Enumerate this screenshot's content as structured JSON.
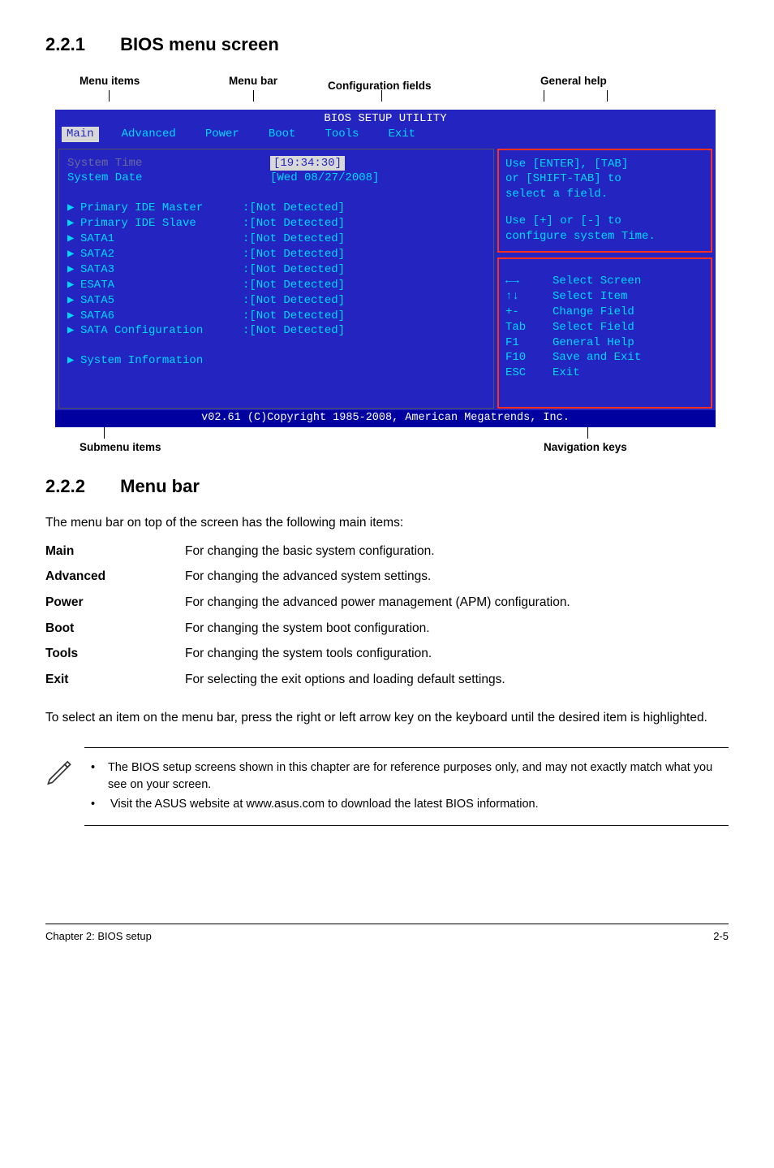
{
  "section1": {
    "num": "2.2.1",
    "title": "BIOS menu screen"
  },
  "topLabels": {
    "menuItems": "Menu items",
    "menuBar": "Menu bar",
    "config": "Configuration fields",
    "help": "General help"
  },
  "bios": {
    "title": "BIOS SETUP UTILITY",
    "menubar": [
      "Main",
      "Advanced",
      "Power",
      "Boot",
      "Tools",
      "Exit"
    ],
    "sysTimeLabel": "System Time",
    "sysTimeVal": "[19:34:30]",
    "sysDateLabel": "System Date",
    "sysDateVal": "[Wed 08/27/2008]",
    "rows": [
      {
        "label": "Primary IDE Master",
        "val": ":[Not Detected]"
      },
      {
        "label": "Primary IDE Slave",
        "val": ":[Not Detected]"
      },
      {
        "label": "SATA1",
        "val": ":[Not Detected]"
      },
      {
        "label": "SATA2",
        "val": ":[Not Detected]"
      },
      {
        "label": "SATA3",
        "val": ":[Not Detected]"
      },
      {
        "label": "ESATA",
        "val": ":[Not Detected]"
      },
      {
        "label": "SATA5",
        "val": ":[Not Detected]"
      },
      {
        "label": "SATA6",
        "val": ":[Not Detected]"
      },
      {
        "label": "SATA Configuration",
        "val": ":[Not Detected]"
      }
    ],
    "sysInfo": "System Information",
    "help1a": "Use [ENTER], [TAB]",
    "help1b": "or [SHIFT-TAB] to",
    "help1c": "select a field.",
    "help2a": "Use [+] or [-] to",
    "help2b": "configure system Time.",
    "nav": [
      {
        "k": "←→",
        "t": "Select Screen"
      },
      {
        "k": "↑↓",
        "t": "Select Item"
      },
      {
        "k": "+-",
        "t": "Change Field"
      },
      {
        "k": "Tab",
        "t": "Select Field"
      },
      {
        "k": "F1",
        "t": "General Help"
      },
      {
        "k": "F10",
        "t": "Save and Exit"
      },
      {
        "k": "ESC",
        "t": "Exit"
      }
    ],
    "copyright": "v02.61 (C)Copyright 1985-2008, American Megatrends, Inc."
  },
  "bottomLabels": {
    "submenu": "Submenu items",
    "nav": "Navigation keys"
  },
  "section2": {
    "num": "2.2.2",
    "title": "Menu bar"
  },
  "intro2": "The menu bar on top of the screen has the following main items:",
  "defs": [
    {
      "k": "Main",
      "v": "For changing the basic system configuration."
    },
    {
      "k": "Advanced",
      "v": "For changing the advanced system settings."
    },
    {
      "k": "Power",
      "v": "For changing the advanced power management (APM) configuration."
    },
    {
      "k": "Boot",
      "v": "For changing the system boot configuration."
    },
    {
      "k": "Tools",
      "v": "For changing the system tools configuration."
    },
    {
      "k": "Exit",
      "v": "For selecting the exit options and loading default settings."
    }
  ],
  "para2": "To select an item on the menu bar, press the right or left arrow key on the keyboard until the desired item is highlighted.",
  "notes": [
    "The BIOS setup screens shown in this chapter are for reference purposes only, and may not exactly match what you see on your screen.",
    "Visit the ASUS website at www.asus.com to download the latest BIOS information."
  ],
  "footer": {
    "left": "Chapter 2: BIOS setup",
    "right": "2-5"
  }
}
